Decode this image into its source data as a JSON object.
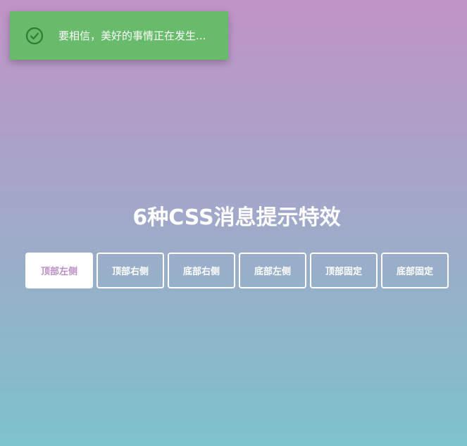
{
  "toast": {
    "icon": "check-circle-icon",
    "message": "要相信，美好的事情正在发生...",
    "background": "#67bb6a"
  },
  "title": "6种CSS消息提示特效",
  "buttons": [
    {
      "label": "顶部左侧",
      "active": true
    },
    {
      "label": "顶部右侧",
      "active": false
    },
    {
      "label": "底部右侧",
      "active": false
    },
    {
      "label": "底部左侧",
      "active": false
    },
    {
      "label": "顶部固定",
      "active": false
    },
    {
      "label": "底部固定",
      "active": false
    }
  ],
  "colors": {
    "gradient_top": "#c193c7",
    "gradient_bottom": "#7dc3cb",
    "active_text": "#b98fc3"
  }
}
